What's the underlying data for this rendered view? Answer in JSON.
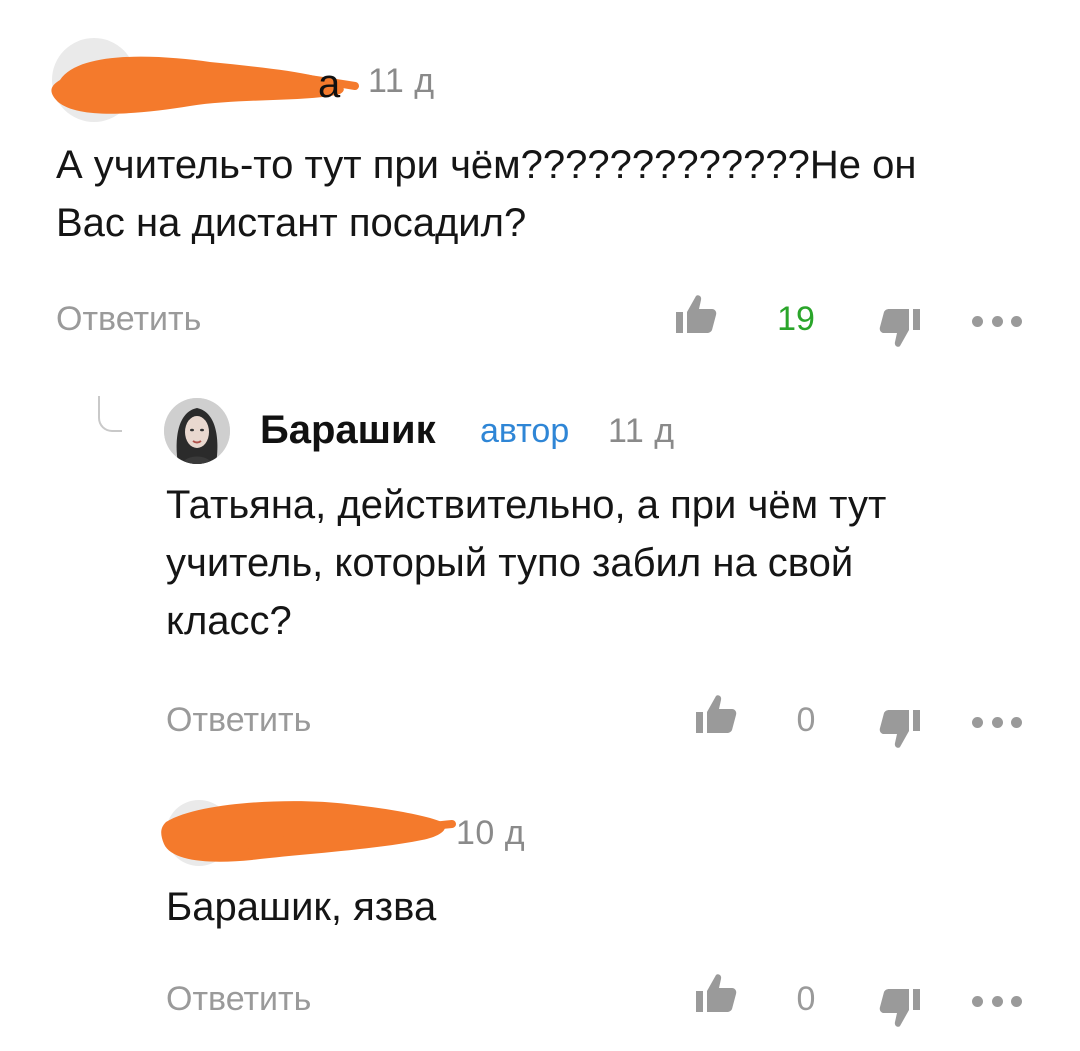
{
  "colors": {
    "redaction": "#f47a2c",
    "like_active": "#2aa52a",
    "muted": "#9a9a9a",
    "author_badge": "#2f86d6"
  },
  "comments": [
    {
      "author_suffix": "а",
      "time": "11 д",
      "text_lines": [
        "А учитель-то тут при чём?????????????Не он",
        "Вас на дистант посадил?"
      ],
      "reply_label": "Ответить",
      "likes": "19",
      "like_icon": "thumbs-up-icon",
      "dislike_icon": "thumbs-down-icon",
      "more_icon": "more-dots-icon"
    },
    {
      "author": "Барашик",
      "badge": "автор",
      "time": "11 д",
      "text_lines": [
        "Татьяна, действительно, а при чём тут",
        "учитель, который тупо забил на свой",
        "класс?"
      ],
      "reply_label": "Ответить",
      "likes": "0",
      "like_icon": "thumbs-up-icon",
      "dislike_icon": "thumbs-down-icon",
      "more_icon": "more-dots-icon"
    },
    {
      "time": "10 д",
      "text_lines": [
        "Барашик, язва"
      ],
      "reply_label": "Ответить",
      "likes": "0",
      "like_icon": "thumbs-up-icon",
      "dislike_icon": "thumbs-down-icon",
      "more_icon": "more-dots-icon"
    }
  ]
}
